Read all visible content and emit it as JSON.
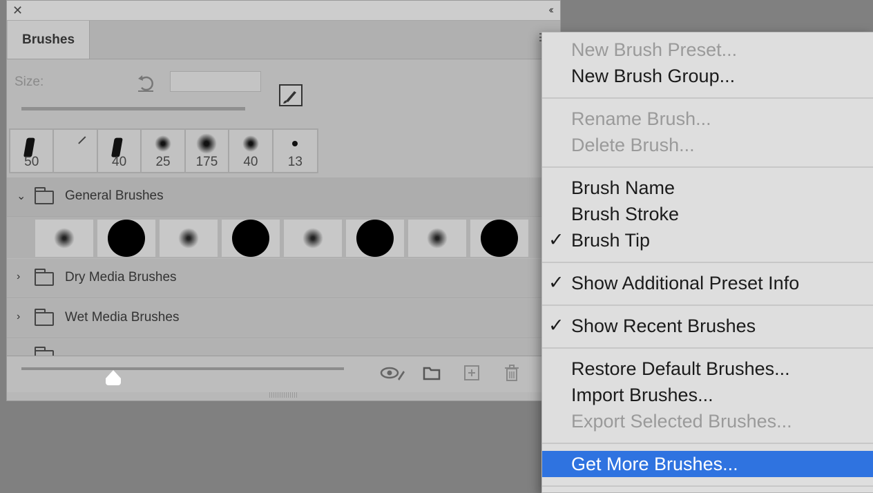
{
  "panel": {
    "close_glyph": "✕",
    "collapse_glyph": "‹‹",
    "tab_label": "Brushes",
    "size_label": "Size:",
    "recent_brushes": [
      {
        "size": "50",
        "kind": "tip-stroke"
      },
      {
        "size": "",
        "kind": "pencil"
      },
      {
        "size": "40",
        "kind": "tip-stroke"
      },
      {
        "size": "25",
        "kind": "soft"
      },
      {
        "size": "175",
        "kind": "soft"
      },
      {
        "size": "40",
        "kind": "soft"
      },
      {
        "size": "13",
        "kind": "hard-small"
      }
    ],
    "groups": [
      {
        "label": "General Brushes",
        "expanded": true,
        "chevron": "⌄"
      },
      {
        "label": "Dry Media Brushes",
        "expanded": false,
        "chevron": "›"
      },
      {
        "label": "Wet Media Brushes",
        "expanded": false,
        "chevron": "›"
      }
    ]
  },
  "menu": {
    "items": [
      {
        "label": "New Brush Preset...",
        "enabled": false,
        "checked": false
      },
      {
        "label": "New Brush Group...",
        "enabled": true,
        "checked": false
      },
      {
        "label": "Rename Brush...",
        "enabled": false,
        "checked": false
      },
      {
        "label": "Delete Brush...",
        "enabled": false,
        "checked": false
      },
      {
        "label": "Brush Name",
        "enabled": true,
        "checked": false
      },
      {
        "label": "Brush Stroke",
        "enabled": true,
        "checked": false
      },
      {
        "label": "Brush Tip",
        "enabled": true,
        "checked": true
      },
      {
        "label": "Show Additional Preset Info",
        "enabled": true,
        "checked": true
      },
      {
        "label": "Show Recent Brushes",
        "enabled": true,
        "checked": true
      },
      {
        "label": "Restore Default Brushes...",
        "enabled": true,
        "checked": false
      },
      {
        "label": "Import Brushes...",
        "enabled": true,
        "checked": false
      },
      {
        "label": "Export Selected Brushes...",
        "enabled": false,
        "checked": false
      },
      {
        "label": "Get More Brushes...",
        "enabled": true,
        "checked": false,
        "highlighted": true
      }
    ],
    "check_glyph": "✓"
  },
  "colors": {
    "highlight": "#2f73e0",
    "panel_bg": "#b8b8b8",
    "menu_bg": "#dedede",
    "disabled_text": "#9a9a9a"
  },
  "icons": {
    "visibility": "eye-brush-icon",
    "new_group": "folder-icon",
    "new_brush": "plus-square-icon",
    "delete": "trash-icon"
  }
}
